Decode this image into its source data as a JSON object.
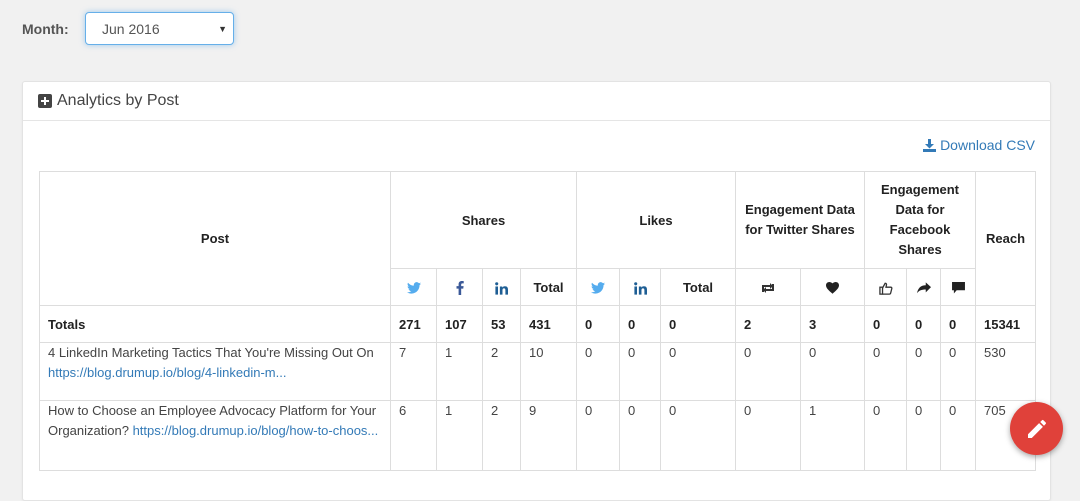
{
  "filter": {
    "label": "Month:",
    "selected": "Jun 2016"
  },
  "panel": {
    "title": "Analytics by Post",
    "download_label": "Download CSV"
  },
  "table": {
    "headers": {
      "post": "Post",
      "shares": "Shares",
      "likes": "Likes",
      "twitter_engagement": "Engagement Data for Twitter Shares",
      "facebook_engagement": "Engagement Data for Facebook Shares",
      "reach": "Reach",
      "total": "Total"
    },
    "icons": {
      "shares": [
        "twitter-icon",
        "facebook-icon",
        "linkedin-icon"
      ],
      "likes": [
        "twitter-icon",
        "linkedin-icon"
      ],
      "twitter_engagement": [
        "retweet-icon",
        "heart-icon"
      ],
      "facebook_engagement": [
        "thumbs-up-icon",
        "share-icon",
        "comment-icon"
      ]
    },
    "totals": {
      "label": "Totals",
      "values": [
        "271",
        "107",
        "53",
        "431",
        "0",
        "0",
        "0",
        "2",
        "3",
        "0",
        "0",
        "0",
        "15341"
      ]
    },
    "rows": [
      {
        "title": "4 LinkedIn Marketing Tactics That You're Missing Out On",
        "url": "https://blog.drumup.io/blog/4-linkedin-m...",
        "values": [
          "7",
          "1",
          "2",
          "10",
          "0",
          "0",
          "0",
          "0",
          "0",
          "0",
          "0",
          "0",
          "530"
        ]
      },
      {
        "title": "How to Choose an Employee Advocacy Platform for Your Organization?",
        "url": "https://blog.drumup.io/blog/how-to-choos...",
        "values": [
          "6",
          "1",
          "2",
          "9",
          "0",
          "0",
          "0",
          "0",
          "1",
          "0",
          "0",
          "0",
          "705"
        ]
      }
    ]
  },
  "colors": {
    "accent": "#337ab7",
    "twitter": "#55acee",
    "facebook": "#3b5998",
    "linkedin": "#1e5e94",
    "fab": "#e0413a"
  }
}
